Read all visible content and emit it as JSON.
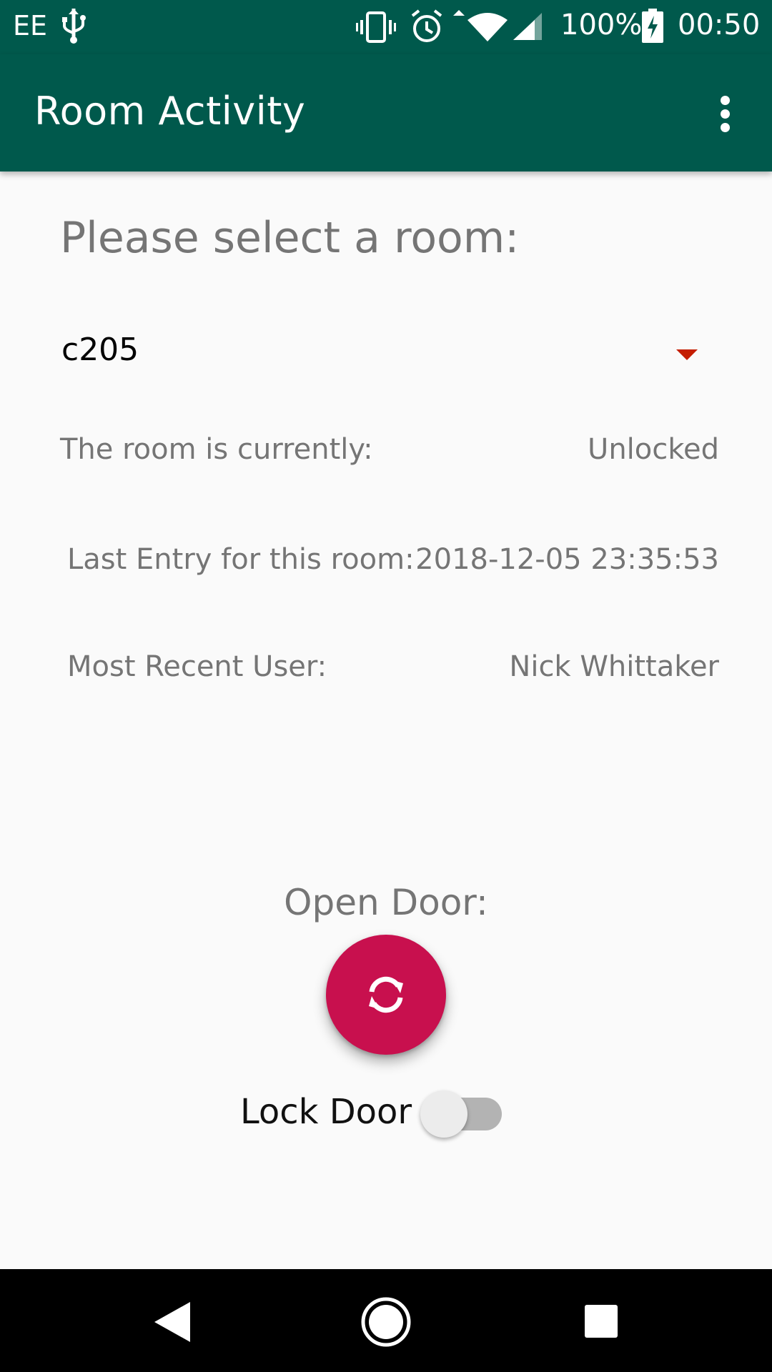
{
  "status_bar": {
    "carrier": "EE",
    "battery_percent": "100%",
    "time": "00:50",
    "icons": [
      "usb-icon",
      "vibrate-icon",
      "alarm-icon",
      "wifi-icon",
      "signal-icon",
      "battery-charging-icon"
    ]
  },
  "app_bar": {
    "title": "Room Activity",
    "overflow_icon": "more-vert-icon"
  },
  "main": {
    "prompt": "Please select a room:",
    "room_spinner": {
      "selected": "c205"
    },
    "info_rows": [
      {
        "label": "The room is currently:",
        "value": "Unlocked"
      },
      {
        "label": "Last Entry for this room:",
        "value": "2018-12-05 23:35:53"
      },
      {
        "label": "Most Recent User:",
        "value": "Nick Whittaker"
      }
    ],
    "open_door_label": "Open Door:",
    "open_door_fab_icon": "sync-icon",
    "lock_door_label": "Lock Door",
    "lock_door_switch_on": false
  },
  "nav_bar": {
    "buttons": [
      "back-icon",
      "home-icon",
      "recents-icon"
    ]
  },
  "colors": {
    "primary": "#00594c",
    "accent": "#c8104e",
    "spinner_arrow": "#c41d00",
    "background": "#fafafa"
  }
}
